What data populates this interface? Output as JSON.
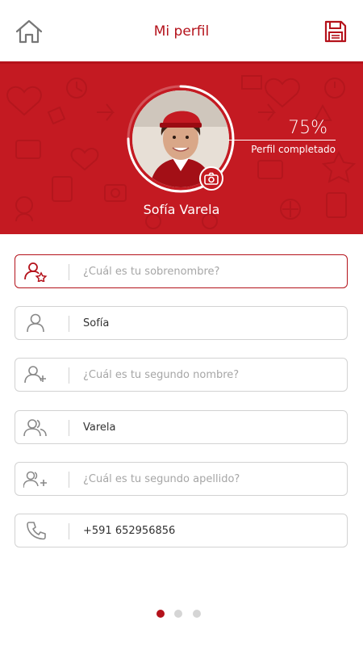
{
  "header": {
    "title": "Mi perfil",
    "home_icon": "home-icon",
    "save_icon": "save-icon"
  },
  "profile": {
    "name": "Sofía Varela",
    "progress_percent": 75,
    "progress_text": "75%",
    "progress_label": "Perfil completado",
    "camera_icon": "camera-icon"
  },
  "fields": [
    {
      "icon": "user-star-icon",
      "value": "",
      "placeholder": "¿Cuál es tu sobrenombre?"
    },
    {
      "icon": "user-icon",
      "value": "Sofía",
      "placeholder": ""
    },
    {
      "icon": "user-add-icon",
      "value": "",
      "placeholder": "¿Cuál es tu segundo nombre?"
    },
    {
      "icon": "users-icon",
      "value": "Varela",
      "placeholder": ""
    },
    {
      "icon": "users-add-icon",
      "value": "",
      "placeholder": "¿Cuál es tu segundo apellido?"
    },
    {
      "icon": "phone-icon",
      "value": "+591 652956856",
      "placeholder": ""
    }
  ],
  "pager": {
    "count": 3,
    "active_index": 0
  },
  "colors": {
    "accent": "#b4121b",
    "hero": "#c41a22",
    "border": "#d2d2d2",
    "placeholder": "#a6a6a6"
  }
}
